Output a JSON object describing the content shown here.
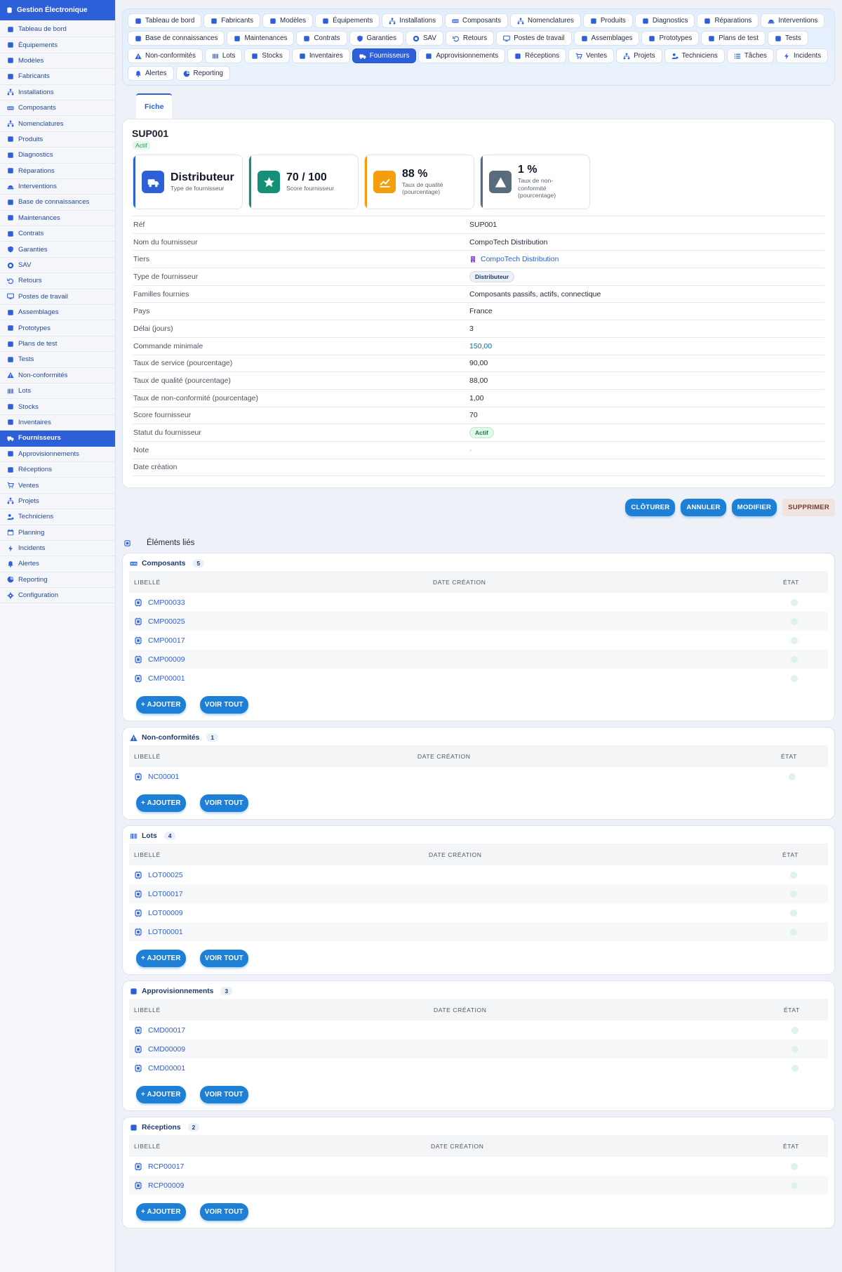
{
  "app": {
    "title": "Gestion Électronique"
  },
  "sidebar": {
    "items": [
      {
        "label": "Tableau de bord",
        "icon": "gauge-icon"
      },
      {
        "label": "Équipements",
        "icon": "database-icon"
      },
      {
        "label": "Modèles",
        "icon": "cube-icon"
      },
      {
        "label": "Fabricants",
        "icon": "industry-icon"
      },
      {
        "label": "Installations",
        "icon": "sitemap-icon"
      },
      {
        "label": "Composants",
        "icon": "memory-icon"
      },
      {
        "label": "Nomenclatures",
        "icon": "hierarchy-icon"
      },
      {
        "label": "Produits",
        "icon": "box-icon"
      },
      {
        "label": "Diagnostics",
        "icon": "stethoscope-icon"
      },
      {
        "label": "Réparations",
        "icon": "wrench-icon"
      },
      {
        "label": "Interventions",
        "icon": "helmet-icon"
      },
      {
        "label": "Base de connaissances",
        "icon": "book-icon"
      },
      {
        "label": "Maintenances",
        "icon": "tools-icon"
      },
      {
        "label": "Contrats",
        "icon": "file-icon"
      },
      {
        "label": "Garanties",
        "icon": "shield-icon"
      },
      {
        "label": "SAV",
        "icon": "lifering-icon"
      },
      {
        "label": "Retours",
        "icon": "undo-icon"
      },
      {
        "label": "Postes de travail",
        "icon": "desktop-icon"
      },
      {
        "label": "Assemblages",
        "icon": "gears-icon"
      },
      {
        "label": "Prototypes",
        "icon": "flask-icon"
      },
      {
        "label": "Plans de test",
        "icon": "clipboard-icon"
      },
      {
        "label": "Tests",
        "icon": "vial-icon"
      },
      {
        "label": "Non-conformités",
        "icon": "warning-icon"
      },
      {
        "label": "Lots",
        "icon": "barcode-icon"
      },
      {
        "label": "Stocks",
        "icon": "warehouse-icon"
      },
      {
        "label": "Inventaires",
        "icon": "clipboard-check-icon"
      },
      {
        "label": "Fournisseurs",
        "icon": "truck-icon",
        "active": true
      },
      {
        "label": "Approvisionnements",
        "icon": "dolly-icon"
      },
      {
        "label": "Réceptions",
        "icon": "truck-ramp-icon"
      },
      {
        "label": "Ventes",
        "icon": "cart-icon"
      },
      {
        "label": "Projets",
        "icon": "diagram-icon"
      },
      {
        "label": "Techniciens",
        "icon": "user-gear-icon"
      },
      {
        "label": "Planning",
        "icon": "calendar-icon"
      },
      {
        "label": "Incidents",
        "icon": "bolt-icon"
      },
      {
        "label": "Alertes",
        "icon": "bell-icon"
      },
      {
        "label": "Reporting",
        "icon": "chart-pie-icon"
      },
      {
        "label": "Configuration",
        "icon": "gear-icon"
      }
    ]
  },
  "tabs": [
    {
      "label": "Tableau de bord",
      "icon": "gauge-icon"
    },
    {
      "label": "Fabricants",
      "icon": "industry-icon"
    },
    {
      "label": "Modèles",
      "icon": "cube-icon"
    },
    {
      "label": "Équipements",
      "icon": "database-icon"
    },
    {
      "label": "Installations",
      "icon": "sitemap-icon"
    },
    {
      "label": "Composants",
      "icon": "memory-icon"
    },
    {
      "label": "Nomenclatures",
      "icon": "hierarchy-icon"
    },
    {
      "label": "Produits",
      "icon": "box-icon"
    },
    {
      "label": "Diagnostics",
      "icon": "stethoscope-icon"
    },
    {
      "label": "Réparations",
      "icon": "wrench-icon"
    },
    {
      "label": "Interventions",
      "icon": "helmet-icon"
    },
    {
      "label": "Base de connaissances",
      "icon": "book-icon"
    },
    {
      "label": "Maintenances",
      "icon": "tools-icon"
    },
    {
      "label": "Contrats",
      "icon": "file-icon"
    },
    {
      "label": "Garanties",
      "icon": "shield-icon"
    },
    {
      "label": "SAV",
      "icon": "lifering-icon"
    },
    {
      "label": "Retours",
      "icon": "undo-icon"
    },
    {
      "label": "Postes de travail",
      "icon": "desktop-icon"
    },
    {
      "label": "Assemblages",
      "icon": "gears-icon"
    },
    {
      "label": "Prototypes",
      "icon": "flask-icon"
    },
    {
      "label": "Plans de test",
      "icon": "clipboard-icon"
    },
    {
      "label": "Tests",
      "icon": "vial-icon"
    },
    {
      "label": "Non-conformités",
      "icon": "warning-icon"
    },
    {
      "label": "Lots",
      "icon": "barcode-icon"
    },
    {
      "label": "Stocks",
      "icon": "warehouse-icon"
    },
    {
      "label": "Inventaires",
      "icon": "clipboard-check-icon"
    },
    {
      "label": "Fournisseurs",
      "icon": "truck-icon",
      "active": true
    },
    {
      "label": "Approvisionnements",
      "icon": "dolly-icon"
    },
    {
      "label": "Réceptions",
      "icon": "truck-ramp-icon"
    },
    {
      "label": "Ventes",
      "icon": "cart-icon"
    },
    {
      "label": "Projets",
      "icon": "diagram-icon"
    },
    {
      "label": "Techniciens",
      "icon": "user-gear-icon"
    },
    {
      "label": "Tâches",
      "icon": "list-icon"
    },
    {
      "label": "Incidents",
      "icon": "bolt-icon"
    },
    {
      "label": "Alertes",
      "icon": "bell-icon"
    },
    {
      "label": "Reporting",
      "icon": "chart-pie-icon"
    }
  ],
  "subtab": {
    "label": "Fiche"
  },
  "record": {
    "ref": "SUP001",
    "status": "Actif",
    "kpis": [
      {
        "value": "Distributeur",
        "label": "Type de fournisseur",
        "color": "#2d5fd8",
        "icon": "truck-icon"
      },
      {
        "value": "70 / 100",
        "label": "Score fournisseur",
        "color": "#149077",
        "icon": "star-icon"
      },
      {
        "value": "88 %",
        "label": "Taux de qualité (pourcentage)",
        "color": "#f59e0b",
        "icon": "chart-line-icon"
      },
      {
        "value": "1 %",
        "label": "Taux de non-conformité (pourcentage)",
        "color": "#5b6b7e",
        "icon": "warning-icon"
      }
    ],
    "fields": [
      {
        "key": "Réf",
        "value": "SUP001"
      },
      {
        "key": "Nom du fournisseur",
        "value": "CompoTech Distribution"
      },
      {
        "key": "Tiers",
        "value": "CompoTech Distribution",
        "type": "link"
      },
      {
        "key": "Type de fournisseur",
        "value": "Distributeur",
        "type": "pill-dist"
      },
      {
        "key": "Familles fournies",
        "value": "Composants passifs, actifs, connectique"
      },
      {
        "key": "Pays",
        "value": "France"
      },
      {
        "key": "Délai (jours)",
        "value": "3"
      },
      {
        "key": "Commande minimale",
        "value": "150,00",
        "type": "num-link"
      },
      {
        "key": "Taux de service (pourcentage)",
        "value": "90,00"
      },
      {
        "key": "Taux de qualité (pourcentage)",
        "value": "88,00"
      },
      {
        "key": "Taux de non-conformité (pourcentage)",
        "value": "1,00"
      },
      {
        "key": "Score fournisseur",
        "value": "70"
      },
      {
        "key": "Statut du fournisseur",
        "value": "Actif",
        "type": "pill-actif"
      },
      {
        "key": "Note",
        "value": "-",
        "type": "dash"
      },
      {
        "key": "Date création",
        "value": ""
      }
    ]
  },
  "actions": {
    "close": "CLÔTURER",
    "cancel": "ANNULER",
    "edit": "MODIFIER",
    "delete": "SUPPRIMER"
  },
  "linked": {
    "title": "Éléments liés",
    "columns": {
      "label": "LIBELLÉ",
      "date": "DATE CRÉATION",
      "state": "ÉTAT"
    },
    "add_label": "+ AJOUTER",
    "view_all_label": "VOIR TOUT",
    "sections": [
      {
        "title": "Composants",
        "count": "5",
        "icon": "memory-icon",
        "rows": [
          "CMP00033",
          "CMP00025",
          "CMP00017",
          "CMP00009",
          "CMP00001"
        ]
      },
      {
        "title": "Non-conformités",
        "count": "1",
        "icon": "warning-icon",
        "rows": [
          "NC00001"
        ]
      },
      {
        "title": "Lots",
        "count": "4",
        "icon": "barcode-icon",
        "rows": [
          "LOT00025",
          "LOT00017",
          "LOT00009",
          "LOT00001"
        ]
      },
      {
        "title": "Approvisionnements",
        "count": "3",
        "icon": "dolly-icon",
        "rows": [
          "CMD00017",
          "CMD00009",
          "CMD00001"
        ]
      },
      {
        "title": "Réceptions",
        "count": "2",
        "icon": "truck-ramp-icon",
        "rows": [
          "RCP00017",
          "RCP00009"
        ]
      }
    ]
  }
}
